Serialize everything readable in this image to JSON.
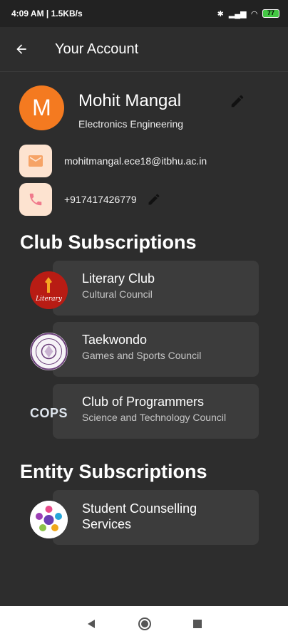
{
  "status_bar": {
    "time": "4:09 AM | 1.5KB/s",
    "battery": "77"
  },
  "header": {
    "title": "Your Account"
  },
  "profile": {
    "avatar_letter": "M",
    "name": "Mohit Mangal",
    "department": "Electronics Engineering",
    "email": "mohitmangal.ece18@itbhu.ac.in",
    "phone": "+917417426779"
  },
  "club_section": {
    "title": "Club Subscriptions",
    "items": [
      {
        "name": "Literary Club",
        "council": "Cultural Council",
        "logo_text": "Literary"
      },
      {
        "name": "Taekwondo",
        "council": "Games and Sports Council"
      },
      {
        "name": "Club of Programmers",
        "council": "Science and Technology Council",
        "logo_text": "COPS"
      }
    ]
  },
  "entity_section": {
    "title": "Entity Subscriptions",
    "items": [
      {
        "name": "Student Counselling Services"
      }
    ]
  },
  "colors": {
    "background": "#2d2d2d",
    "card": "#3c3c3c",
    "avatar": "#f47a20",
    "icon_bg": "#fde3d0",
    "battery": "#44c744"
  },
  "icons": {
    "back": "arrow-left-icon",
    "edit": "pencil-icon",
    "email": "mail-icon",
    "phone": "phone-icon"
  }
}
